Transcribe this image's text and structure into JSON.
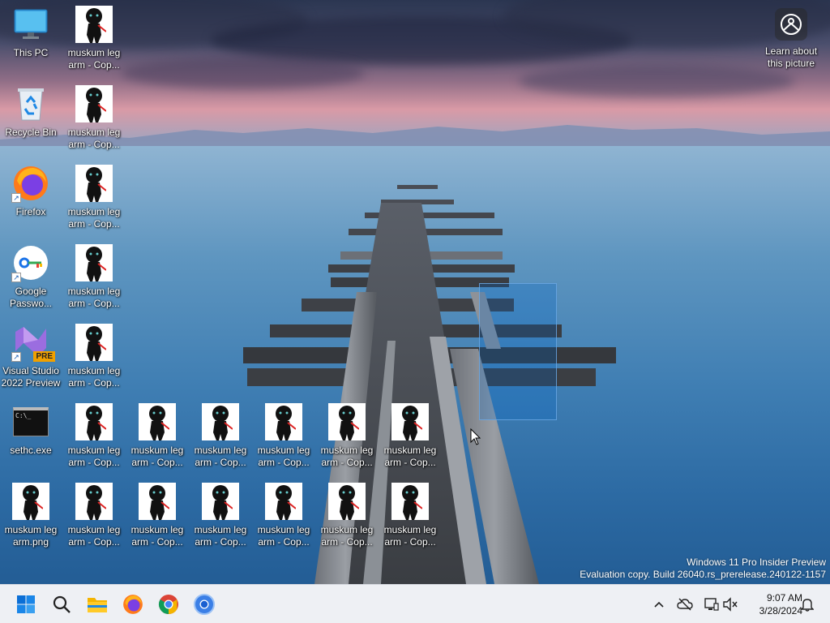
{
  "desktop": {
    "icons": [
      {
        "label": "This PC",
        "icon": "this-pc-icon"
      },
      {
        "label": "Recycle Bin",
        "icon": "recycle-bin-icon"
      },
      {
        "label": "Firefox",
        "icon": "firefox-icon"
      },
      {
        "label": "Google Passwo...",
        "icon": "google-password-manager-icon"
      },
      {
        "label": "Visual Studio 2022 Preview",
        "icon": "visual-studio-icon",
        "badge": "PRE"
      },
      {
        "label": "sethc.exe",
        "icon": "cmd-icon",
        "cmd_text": "C:\\_"
      },
      {
        "label": "muskum leg arm.png",
        "icon": "image-file-icon"
      }
    ],
    "copy_label": "muskum leg arm - Cop...",
    "learn_label": "Learn about this picture"
  },
  "watermark": {
    "line1": "Windows 11 Pro Insider Preview",
    "line2": "Evaluation copy. Build 26040.rs_prerelease.240122-1157"
  },
  "taskbar": {
    "time": "9:07 AM",
    "date": "3/28/2024"
  },
  "colors": {
    "accent": "#0067c0",
    "taskbar_bg": "#eef0f4"
  }
}
